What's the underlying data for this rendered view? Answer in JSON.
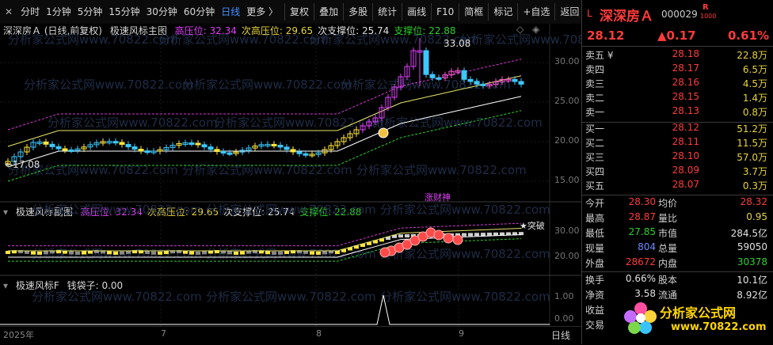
{
  "toolbar": {
    "close": "✕",
    "periods": [
      "分时",
      "1分钟",
      "5分钟",
      "15分钟",
      "30分钟",
      "60分钟",
      "日线",
      "更多 〉"
    ],
    "active_period": "日线",
    "buttons": [
      "复权",
      "叠加",
      "多股",
      "统计",
      "画线",
      "F10",
      "简框",
      "标记",
      "+自选",
      "返回"
    ]
  },
  "main": {
    "title": "深深房Ａ (日线,前复权)",
    "indicator": "极速风标主图",
    "labels": [
      {
        "text": "高压位: 32.34",
        "color": "#e040fb"
      },
      {
        "text": "次高压位: 29.65",
        "color": "#e6d33c"
      },
      {
        "text": "次支撑位: 25.74",
        "color": "#e0e0e0"
      },
      {
        "text": "支撑位: 22.88",
        "color": "#2cd12c"
      }
    ],
    "y_ticks": [
      "30.00",
      "25.00",
      "20.00",
      "15.00"
    ],
    "high_note": "33.08",
    "low_note": "←17.08",
    "badge": "涨财神"
  },
  "sub": {
    "indicator": "极速风标副图",
    "labels": [
      {
        "text": "高压位: 32.34",
        "color": "#e040fb"
      },
      {
        "text": "次高压位: 29.65",
        "color": "#e6d33c"
      },
      {
        "text": "次支撑位: 25.74",
        "color": "#e0e0e0"
      },
      {
        "text": "支撑位: 22.88",
        "color": "#2cd12c"
      }
    ],
    "y_ticks": [
      "30.00",
      "20.00"
    ],
    "breakout": "★突破"
  },
  "third": {
    "indicator": "极速风标F",
    "value_label": "钱袋子: 0.00",
    "y_ticks": [
      "1.00",
      "0.00"
    ]
  },
  "xaxis": {
    "labels": [
      "2025年",
      "7",
      "8",
      "9"
    ],
    "right": "日线"
  },
  "watermark": "分析家公式网www.70822.com",
  "quote": {
    "level": "L",
    "name": "深深房Ａ",
    "code": "000029",
    "badge_top": "R",
    "badge_bot": "1000",
    "price": "28.12",
    "change": "▲0.17",
    "pct": "0.61%",
    "asks": [
      {
        "label": "卖五 ¥",
        "price": "28.18",
        "vol": "22.8万"
      },
      {
        "label": "卖四",
        "price": "28.17",
        "vol": "6.5万"
      },
      {
        "label": "卖三",
        "price": "28.16",
        "vol": "4.5万"
      },
      {
        "label": "卖二",
        "price": "28.15",
        "vol": "1.4万"
      },
      {
        "label": "卖一",
        "price": "28.13",
        "vol": "0.8万"
      }
    ],
    "bids": [
      {
        "label": "买一",
        "price": "28.12",
        "vol": "51.2万"
      },
      {
        "label": "买二",
        "price": "28.11",
        "vol": "11.5万"
      },
      {
        "label": "买三",
        "price": "28.10",
        "vol": "57.0万"
      },
      {
        "label": "买四",
        "price": "28.09",
        "vol": "3.7万"
      },
      {
        "label": "买五",
        "price": "28.07",
        "vol": "0.3万"
      }
    ],
    "stats": [
      {
        "l1": "今开",
        "v1": "28.30",
        "c1": "red",
        "l2": "均价",
        "v2": "28.32",
        "c2": "red"
      },
      {
        "l1": "最高",
        "v1": "28.87",
        "c1": "red",
        "l2": "量比",
        "v2": "0.95",
        "c2": "yellow"
      },
      {
        "l1": "最低",
        "v1": "27.85",
        "c1": "green",
        "l2": "市值",
        "v2": "284.5亿",
        "c2": "white"
      },
      {
        "l1": "现量",
        "v1": "804",
        "c1": "blue",
        "l2": "总量",
        "v2": "59050",
        "c2": "white"
      },
      {
        "l1": "外盘",
        "v1": "28672",
        "c1": "red",
        "l2": "内盘",
        "v2": "30378",
        "c2": "green"
      }
    ],
    "stats2": [
      {
        "l1": "换手",
        "v1": "0.66%",
        "l2": "股本",
        "v2": "10.1亿"
      },
      {
        "l1": "净资",
        "v1": "3.58",
        "l2": "流通",
        "v2": "8.92亿"
      },
      {
        "l1": "收益",
        "v1": "",
        "l2": "",
        "v2": ""
      },
      {
        "l1": "交易",
        "v1": "",
        "l2": "",
        "v2": ""
      }
    ],
    "logo_text": "分析家公式网",
    "logo_url": "www.70822.com"
  },
  "colors": {
    "up": "#ff3b3b",
    "down": "#2cd12c",
    "accent": "#4a90ff",
    "pressure": "#e040fb",
    "sub_pressure": "#e6d33c",
    "sub_support": "#e0e0e0",
    "support": "#2cd12c"
  }
}
